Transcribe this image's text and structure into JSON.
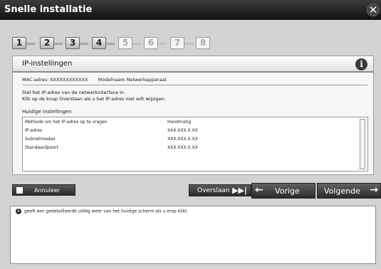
{
  "window": {
    "title": "Snelle installatie",
    "close_symbol": "✕"
  },
  "steps": [
    {
      "label": "1",
      "state": "done"
    },
    {
      "label": "2",
      "state": "done"
    },
    {
      "label": "3",
      "state": "done"
    },
    {
      "label": "4",
      "state": "current"
    },
    {
      "label": "5",
      "state": "todo"
    },
    {
      "label": "6",
      "state": "todo"
    },
    {
      "label": "7",
      "state": "todo"
    },
    {
      "label": "8",
      "state": "todo"
    }
  ],
  "panel": {
    "title": "IP-instellingen",
    "mac_label": "MAC-adres: XXXXXXXXXXXX",
    "model_label": "Modelnaam Netwerkapparaat",
    "instruction_line1": "Stel het IP-adres van de netwerkinterface in.",
    "instruction_line2": "Klik op de knop Overslaan als u het IP-adres niet wilt wijzigen.",
    "current_settings_title": "Huidige instellingen",
    "rows": [
      {
        "label": "Methode om het IP-adres op te vragen",
        "value": "Handmatig"
      },
      {
        "label": "IP-adres",
        "value": "XXX.XXX.X.XX"
      },
      {
        "label": "Subnetmasker",
        "value": "XXX.XXX.X.XX"
      },
      {
        "label": "Standaardpoort",
        "value": "XXX.XXX.X.XX"
      }
    ]
  },
  "buttons": {
    "cancel": "Annuleer",
    "skip": "Overslaan",
    "prev": "Vorige",
    "next": "Volgende"
  },
  "help": {
    "text": "geeft een gedetailleerde uitleg weer van het huidige scherm als u erop klikt."
  }
}
